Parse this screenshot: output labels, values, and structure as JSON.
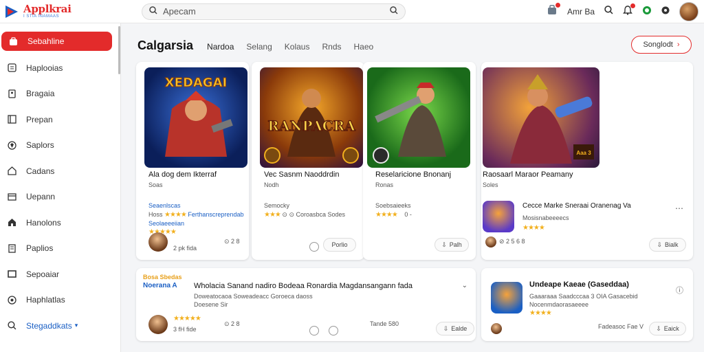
{
  "header": {
    "logo_title": "Applkrai",
    "logo_sub": "I STIA INAMAAS",
    "search_value": "Apecam",
    "user_label": "Amr Ba"
  },
  "sidebar": {
    "items": [
      {
        "label": "Sebahline",
        "icon": "store-icon"
      },
      {
        "label": "Haplooias",
        "icon": "grid-icon"
      },
      {
        "label": "Bragaia",
        "icon": "tag-icon"
      },
      {
        "label": "Prepan",
        "icon": "book-icon"
      },
      {
        "label": "Saplors",
        "icon": "shield-icon"
      },
      {
        "label": "Cadans",
        "icon": "home-icon"
      },
      {
        "label": "Uepann",
        "icon": "window-icon"
      },
      {
        "label": "Hanolons",
        "icon": "house-icon"
      },
      {
        "label": "Paplios",
        "icon": "doc-icon"
      },
      {
        "label": "Sepoaiar",
        "icon": "monitor-icon"
      },
      {
        "label": "Haphlatlas",
        "icon": "globe-icon"
      },
      {
        "label": "Stegaddkats",
        "icon": "search-icon"
      }
    ]
  },
  "main": {
    "category_title": "Calgarsia",
    "tabs": [
      "Nardoa",
      "Selang",
      "Kolaus",
      "Rnds",
      "Haeo"
    ],
    "sort_label": "Songlodt"
  },
  "cards": [
    {
      "title": "Ala dog dem Ikterraf",
      "sub": "Soas",
      "meta1": "Seaenlscas",
      "meta2": "Hoss",
      "meta2b": "Ferthanscreprendab",
      "meta3": "Seolaeeeiian",
      "count": "2 pk fida",
      "extra": "⊙ 2 8",
      "art_title": "XEDAGAI"
    },
    {
      "title": "Vec Sasnm Naoddrdin",
      "sub": "Nodh",
      "meta1": "Semocky",
      "meta2": "⊙ ⊙ Coroasbca Sodes",
      "pill": "Porlio",
      "art_title": "RANPACRA"
    },
    {
      "title": "Reselaricione Bnonanj",
      "sub": "Ronas",
      "meta1": "Soebsaieeks",
      "meta2": "0 -",
      "pill": "Palh"
    },
    {
      "title": "Raosaarl Maraor Peamany",
      "sub": "Soles",
      "app_title": "Cecce Marke Sneraai Oranenag Va",
      "app_sub": "Mosisnabeeeecs",
      "stat": "⊘ 2 5 6 8",
      "pill": "Bialk",
      "pill_label": "Aaa 3"
    },
    {
      "title": "Wholacia Sanand nadiro Bodeaa Ronardia Magdansangann fada",
      "tag1": "Bosa Sbedas",
      "tag2": "Noerana A",
      "meta1": "Doweatocaoa Soweadeacc Goroeca daoss",
      "meta2": "Doesene Sir",
      "count": "3 fH fide",
      "extra": "⊙ 2 8",
      "pill": "Ealde",
      "stat": "Tande 580"
    },
    {
      "title": "Undeape Kaeae (Gaseddaa)",
      "sub1": "Gaaaraaa Saadcccaa 3 OIA Gasacebid",
      "sub2": "Nocenmdaorasaeeee",
      "stat": "Fadeasoc Fae V",
      "pill": "Eaick"
    }
  ]
}
